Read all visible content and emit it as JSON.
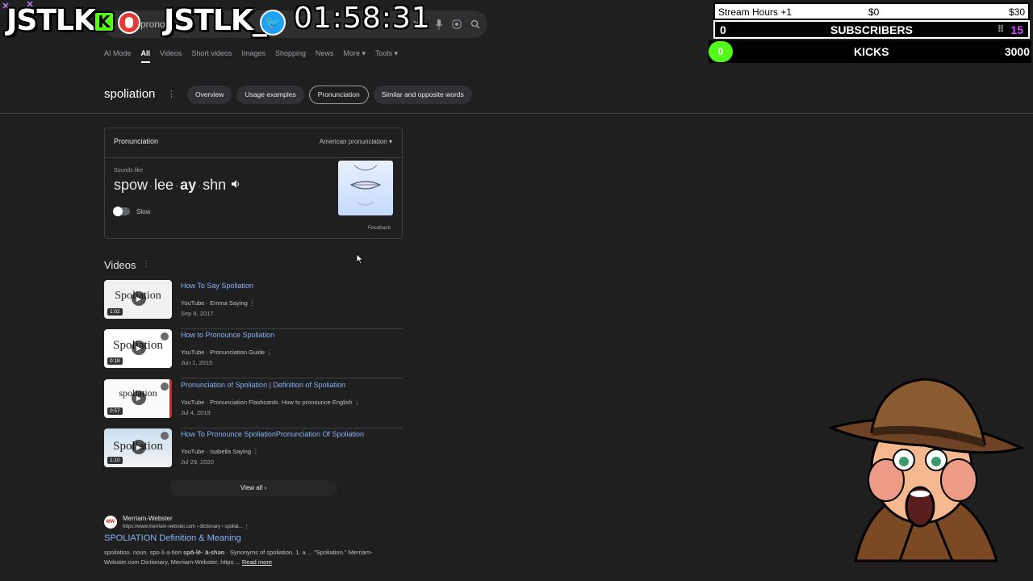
{
  "overlay": {
    "brand_left": "JSTLK",
    "brand_right": "JSTLK_",
    "kick_letter": "K",
    "twitter_glyph": "🐦",
    "timer": "01:58:31",
    "goals": {
      "stream_hours_label": "Stream Hours +1",
      "stream_hours_mid": "$0",
      "stream_hours_target": "$30",
      "subs_count": "0",
      "subs_label": "SUBSCRIBERS",
      "subs_target": "15",
      "kicks_count": "0",
      "kicks_label": "KICKS",
      "kicks_target": "3000"
    },
    "accent_kick": "#53fc18",
    "accent_twitter": "#1da1f2"
  },
  "search": {
    "query_partial": "pronou",
    "icons": [
      "clear-icon",
      "mic-icon",
      "lens-icon",
      "search-icon"
    ],
    "tabs": [
      "AI Mode",
      "All",
      "Videos",
      "Short videos",
      "Images",
      "Shopping",
      "News",
      "More ▾",
      "Tools ▾"
    ],
    "active_tab": "All"
  },
  "word": {
    "title": "spoliation",
    "chips": [
      "Overview",
      "Usage examples",
      "Pronunciation",
      "Similar and opposite words"
    ],
    "selected_chip": "Pronunciation"
  },
  "pronunciation": {
    "heading": "Pronunciation",
    "variant": "American pronunciation ▾",
    "sounds_like": "Sounds like",
    "syllables": [
      "spow",
      "lee",
      "ay",
      "shn"
    ],
    "stressed_index": 2,
    "slow_label": "Slow",
    "feedback": "Feedback"
  },
  "videos": {
    "heading": "Videos",
    "items": [
      {
        "title": "How To Say Spoliation",
        "source": "YouTube · Emma Saying",
        "date": "Sep 8, 2017",
        "duration": "1:02",
        "thumb_text": "Spoliation"
      },
      {
        "title": "How to Pronounce Spoliation",
        "source": "YouTube · Pronunciation Guide",
        "date": "Jun 1, 2015",
        "duration": "0:18",
        "thumb_text": "Spoliation"
      },
      {
        "title": "Pronunciation of Spoliation | Definition of Spoliation",
        "source": "YouTube · Pronunciation Flashcards. How to pronounce English",
        "date": "Jul 4, 2019",
        "duration": "0:57",
        "thumb_text": "spoliation"
      },
      {
        "title": "How To Pronounce SpoliationPronunciation Of Spoliation",
        "source": "YouTube · Isabella Saying",
        "date": "Jul 29, 2020",
        "duration": "1:10",
        "thumb_text": "Spoliation"
      }
    ],
    "view_all": "View all  ›"
  },
  "result": {
    "logo_text": "MW",
    "site": "Merriam-Webster",
    "url": "https://www.merriam-webster.com › dictionary › spoliat...",
    "title": "SPOLIATION Definition & Meaning",
    "snippet_a": "spoliation. noun. spo·​li·​a·​tion ",
    "snippet_bold": "spō-lē-ˈā-shən",
    "snippet_b": " · Synonyms of spoliation. 1. a ... \"Spoliation.\" Merriam-Webster.com Dictionary, Merriam-Webster, https ... ",
    "read_more": "Read more"
  }
}
